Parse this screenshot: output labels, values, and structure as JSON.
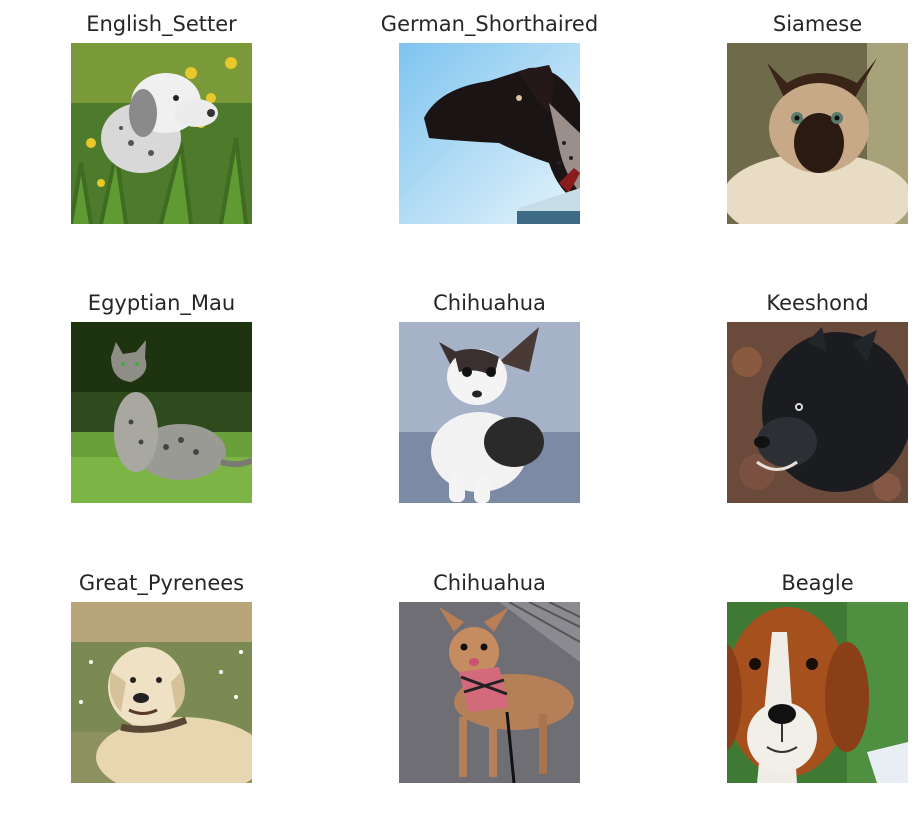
{
  "grid": {
    "cells": [
      {
        "label": "English_Setter"
      },
      {
        "label": "German_Shorthaired"
      },
      {
        "label": "Siamese"
      },
      {
        "label": "Egyptian_Mau"
      },
      {
        "label": "Chihuahua"
      },
      {
        "label": "Keeshond"
      },
      {
        "label": "Great_Pyrenees"
      },
      {
        "label": "Chihuahua"
      },
      {
        "label": "Beagle"
      }
    ]
  }
}
